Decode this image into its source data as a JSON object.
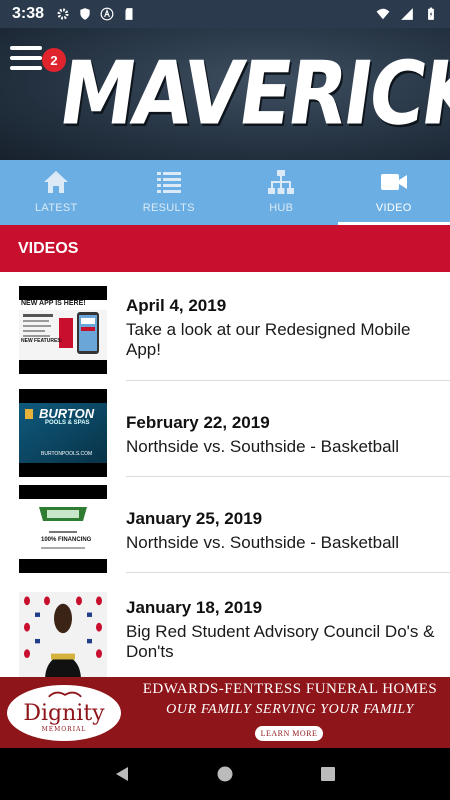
{
  "status_bar": {
    "time": "3:38",
    "left_icons": [
      "gear-icon",
      "shield-icon",
      "a-icon",
      "sd-card-icon"
    ],
    "right_icons": [
      "wifi-icon",
      "signal-icon",
      "battery-icon"
    ]
  },
  "header": {
    "title": "MAVERICKS",
    "menu_badge": "2"
  },
  "tabs": [
    {
      "label": "LATEST",
      "icon": "home-icon",
      "active": false
    },
    {
      "label": "RESULTS",
      "icon": "list-icon",
      "active": false
    },
    {
      "label": "HUB",
      "icon": "hub-icon",
      "active": false
    },
    {
      "label": "VIDEO",
      "icon": "video-camera-icon",
      "active": true
    }
  ],
  "section": {
    "title": "VIDEOS"
  },
  "videos": [
    {
      "date": "April 4, 2019",
      "title": "Take a look at our Redesigned Mobile App!",
      "thumb_headline": "NEW APP IS HERE!",
      "thumb_sub": "NEW FEATURES:"
    },
    {
      "date": "February 22, 2019",
      "title": "Northside vs. Southside - Basketball",
      "thumb_headline": "BURTON",
      "thumb_sub": "POOLS & SPAS",
      "thumb_extra": "BURTONPOOLS.COM"
    },
    {
      "date": "January 25, 2019",
      "title": "Northside vs. Southside - Basketball",
      "thumb_headline": "100% FINANCING"
    },
    {
      "date": "January 18, 2019",
      "title": "Big Red Student Advisory Council Do's & Don'ts"
    }
  ],
  "ad": {
    "logo_text": "Dignity",
    "logo_sub": "MEMORIAL",
    "headline": "EDWARDS-FENTRESS FUNERAL HOMES",
    "tagline": "OUR FAMILY SERVING YOUR FAMILY",
    "cta": "LEARN MORE"
  },
  "colors": {
    "tab_bar": "#6aaee3",
    "section_header": "#c8102e",
    "ad_background": "#8e1519",
    "header_background": "#243241"
  }
}
